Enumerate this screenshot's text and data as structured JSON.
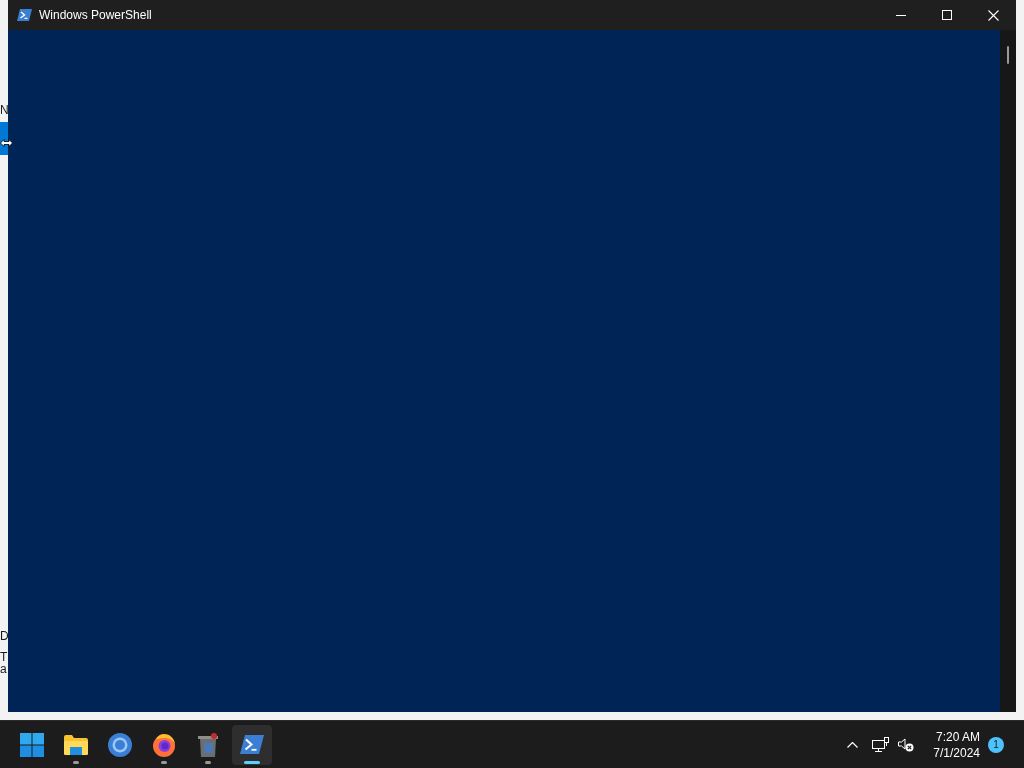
{
  "background_window": {
    "text_fragments": [
      "N",
      "D",
      "T",
      "a"
    ]
  },
  "window": {
    "title": "Windows PowerShell"
  },
  "taskbar": {
    "apps": [
      {
        "kind": "explorer",
        "running": true,
        "selected": false
      },
      {
        "kind": "browser",
        "running": false,
        "selected": false
      },
      {
        "kind": "firefox",
        "running": true,
        "selected": false
      },
      {
        "kind": "recycle",
        "running": true,
        "selected": false
      },
      {
        "kind": "powershell",
        "running": true,
        "selected": true
      }
    ],
    "tray": {
      "volume_muted": true,
      "time": "7:20 AM",
      "date": "7/1/2024",
      "notification_count": "1"
    }
  }
}
